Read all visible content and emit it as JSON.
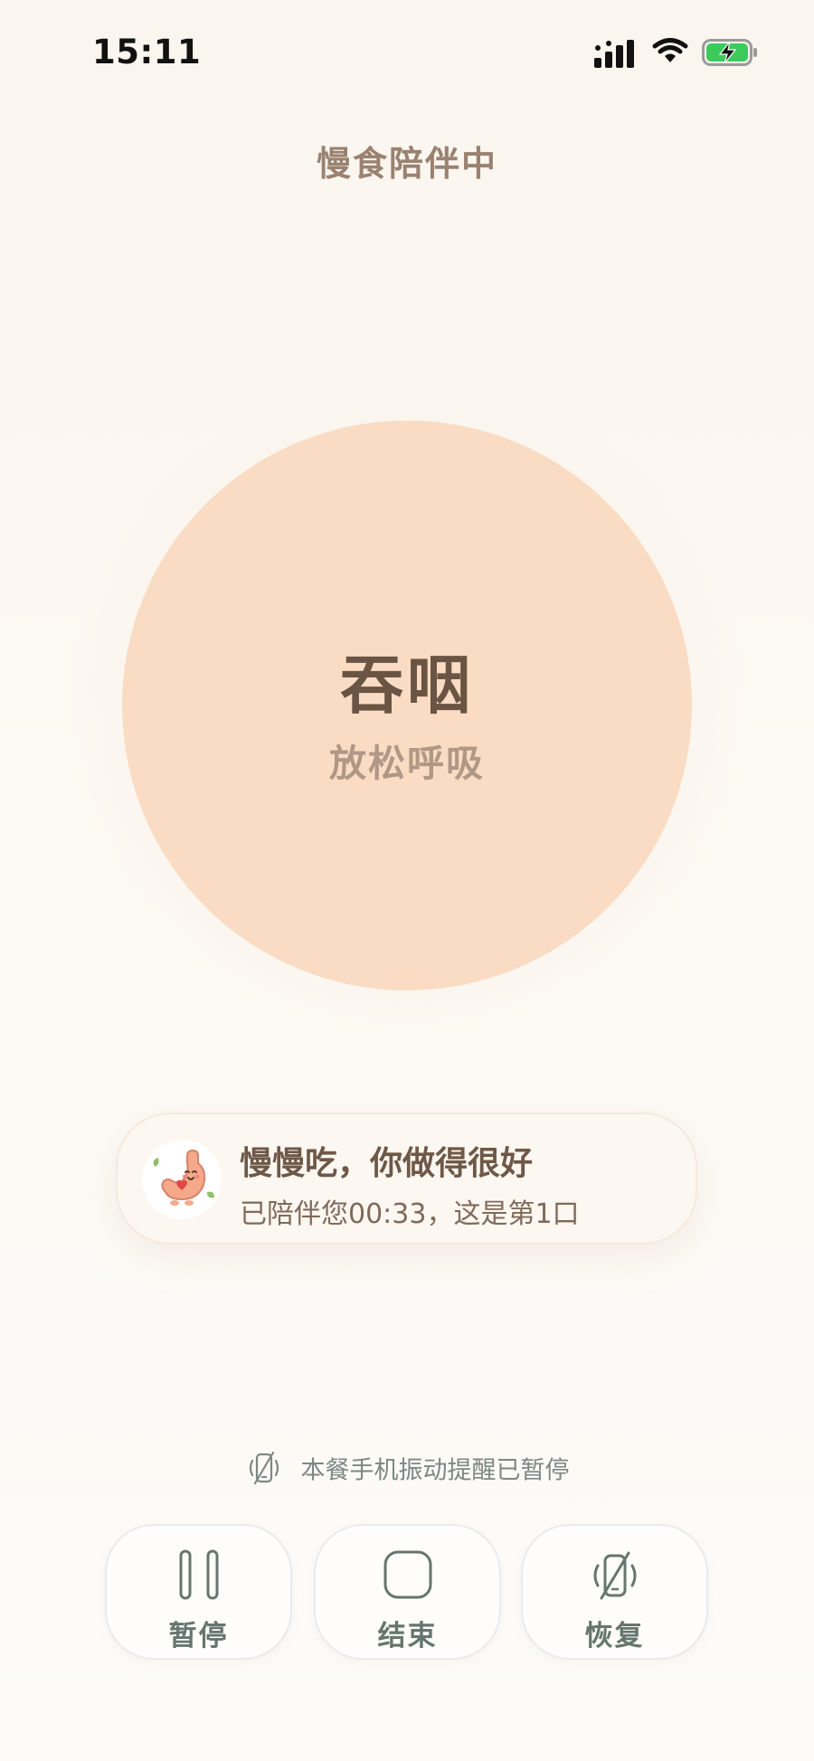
{
  "status_bar": {
    "time": "15:11"
  },
  "header": {
    "title": "慢食陪伴中"
  },
  "breathing": {
    "main_text": "吞咽",
    "sub_text": "放松呼吸"
  },
  "encouragement": {
    "title": "慢慢吃，你做得很好",
    "subtitle": "已陪伴您00:33，这是第1口"
  },
  "vibration_notice": {
    "text": "本餐手机振动提醒已暂停"
  },
  "controls": {
    "pause_label": "暂停",
    "end_label": "结束",
    "resume_label": "恢复"
  },
  "colors": {
    "background": "#fbf5ef",
    "circle": "#f9dcc3",
    "title_text": "#9a8270",
    "button_text": "#667570",
    "battery_charge": "#3ccb5a"
  },
  "icons": {
    "status": [
      "cellular-signal-icon",
      "wifi-icon",
      "battery-charging-icon"
    ],
    "card": "stomach-mascot-icon",
    "notice": "vibration-off-icon",
    "controls": [
      "pause-icon",
      "stop-icon",
      "vibration-off-icon"
    ]
  }
}
